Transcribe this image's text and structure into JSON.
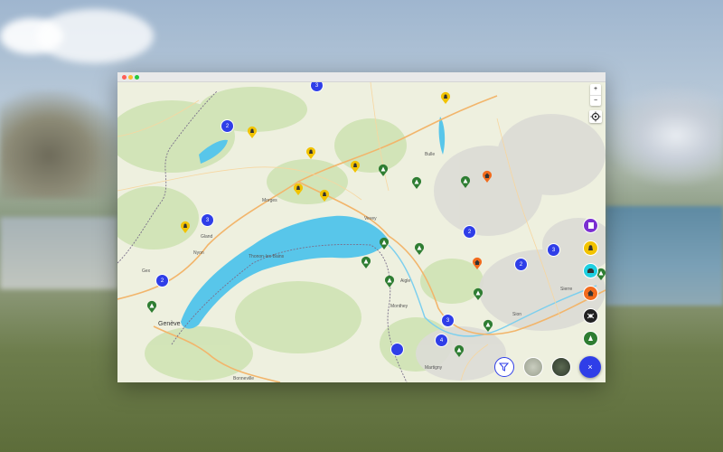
{
  "window": {
    "title": ""
  },
  "map": {
    "labels": {
      "bulle": "Bulle",
      "morges": "Morges",
      "vevey": "Vevey",
      "gland": "Gland",
      "nyon": "Nyon",
      "gex": "Gex",
      "thonon": "Thonon-les-Bains",
      "aigle": "Aigle",
      "monthey": "Monthey",
      "sion": "Sion",
      "sierre": "Sierre",
      "martigny": "Martigny",
      "geneve": "Genève",
      "bonneville": "Bonneville"
    },
    "clusters": [
      "3",
      "2",
      "3",
      "2",
      "2",
      "3",
      "2",
      "3",
      "4"
    ]
  },
  "controls": {
    "zoom_in": "+",
    "zoom_out": "−",
    "close": "×"
  },
  "colors": {
    "cluster": "#2f3ee8",
    "pin_yellow": "#f2c300",
    "pin_green": "#2e7d32",
    "pin_orange": "#f26b1d",
    "lake": "#58c6ea",
    "fab_purple": "#7b2fd1",
    "fab_cyan": "#1ecfe0",
    "fab_black": "#222222"
  },
  "icons": [
    "bell-icon",
    "tree-icon",
    "house-icon",
    "plus-icon",
    "minus-icon",
    "locate-icon",
    "close-icon",
    "filter-icon",
    "layers-icon",
    "spider-icon",
    "car-icon"
  ]
}
